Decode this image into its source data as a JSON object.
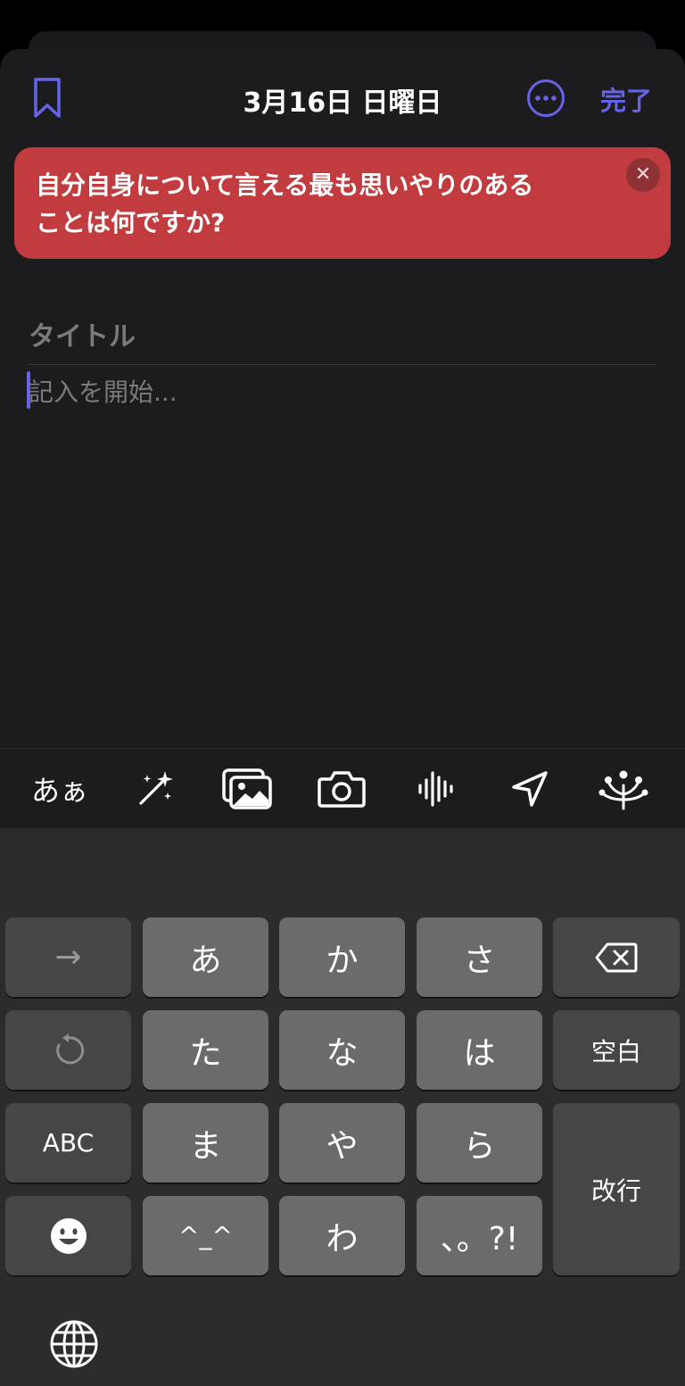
{
  "header": {
    "date_title": "3月16日 日曜日",
    "done_label": "完了",
    "accent_color": "#6563e6"
  },
  "prompt": {
    "line1": "自分自身について言える最も思いやりのある",
    "line2": "ことは何ですか?",
    "close_glyph": "✕",
    "background_color": "#c23b3e"
  },
  "editor": {
    "title_placeholder": "タイトル",
    "body_placeholder": "記入を開始..."
  },
  "toolbar": {
    "text_style_label": "あぁ",
    "icons": [
      "magic-wand-icon",
      "photo-library-icon",
      "camera-icon",
      "waveform-icon",
      "location-arrow-icon",
      "sparkle-burst-icon"
    ]
  },
  "keyboard": {
    "row1": [
      "→",
      "あ",
      "か",
      "さ"
    ],
    "row2": [
      "た",
      "な",
      "は",
      "空白"
    ],
    "row3": [
      "ABC",
      "ま",
      "や",
      "ら",
      "改行"
    ],
    "row4": [
      "^_^",
      "わ",
      "、。?!"
    ],
    "icons": [
      "delete-icon",
      "undo-icon",
      "emoji-icon",
      "globe-icon"
    ]
  }
}
